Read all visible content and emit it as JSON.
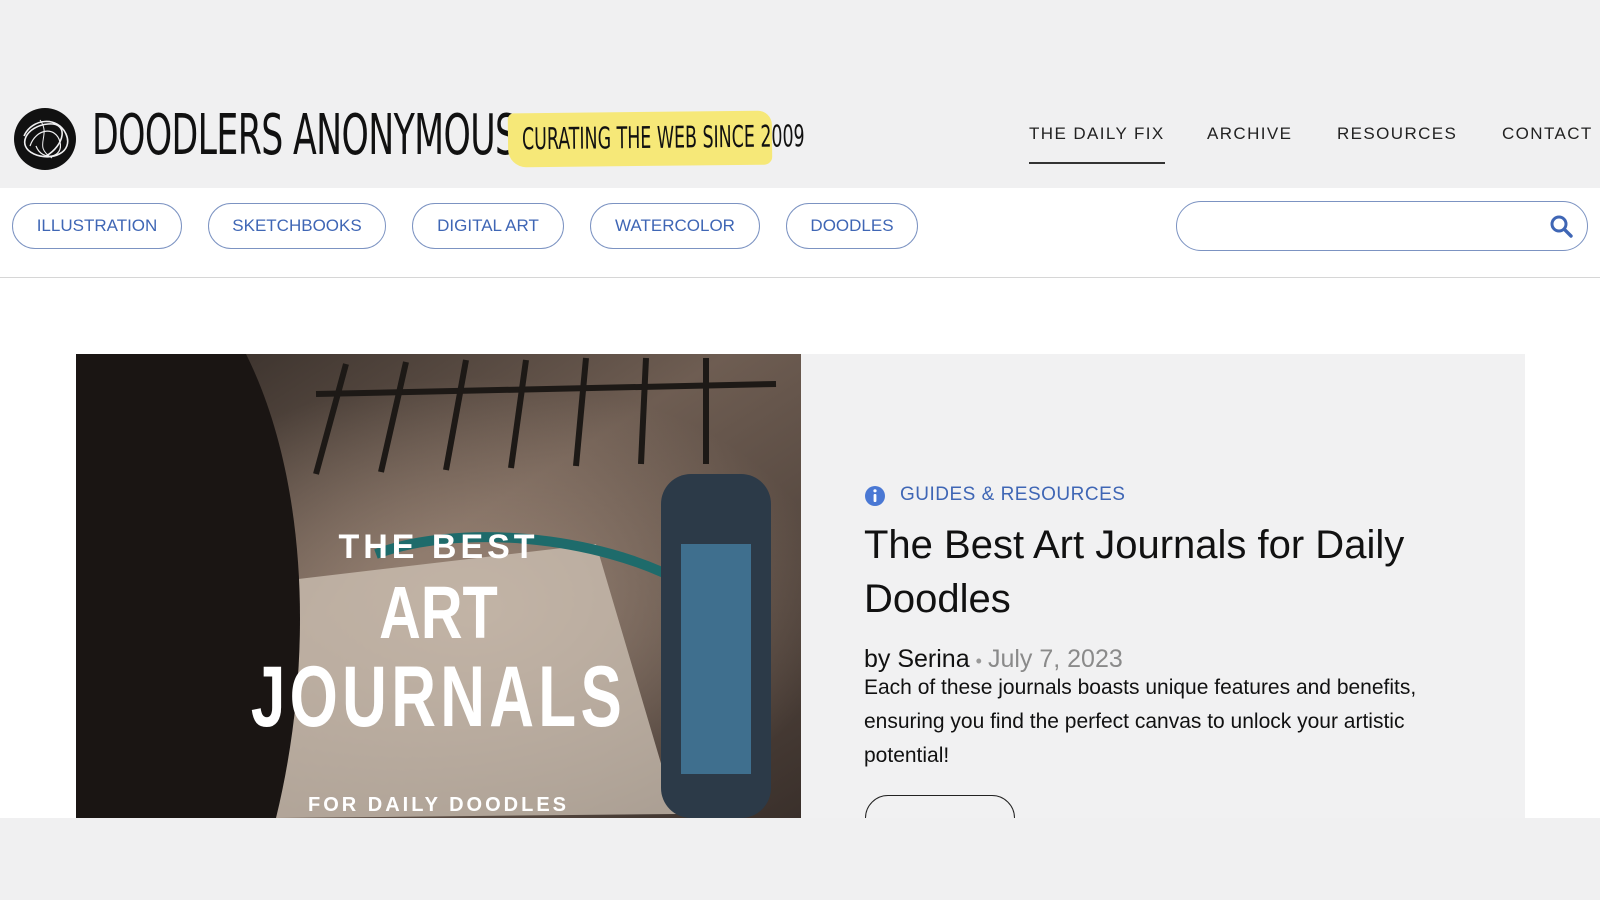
{
  "brand": {
    "name": "DOODLERS ANONYMOUS",
    "tagline": "CURATING THE WEB SINCE 2009"
  },
  "nav": {
    "items": [
      {
        "label": "THE DAILY FIX",
        "active": true
      },
      {
        "label": "ARCHIVE"
      },
      {
        "label": "RESOURCES"
      },
      {
        "label": "CONTACT"
      }
    ]
  },
  "categories": [
    "ILLUSTRATION",
    "SKETCHBOOKS",
    "DIGITAL ART",
    "WATERCOLOR",
    "DOODLES"
  ],
  "search": {
    "placeholder": "",
    "value": "",
    "icon": "search-icon"
  },
  "featured": {
    "image_text": {
      "line1": "THE BEST",
      "line2": "ART",
      "line3": "JOURNALS",
      "line4": "FOR DAILY DOODLES"
    },
    "category": "GUIDES & RESOURCES",
    "category_icon": "info-icon",
    "title": "The Best Art Journals for Daily Doodles",
    "author": "by Serina",
    "separator": "•",
    "date": "July 7, 2023",
    "excerpt": "Each of these journals boasts unique features and benefits, ensuring you find the perfect canvas to unlock your artistic potential!"
  },
  "colors": {
    "accent": "#3f66b5",
    "tagline_bg": "#f6e878",
    "page_bg": "#f0f0f1",
    "card_bg": "#f1f1f2"
  }
}
